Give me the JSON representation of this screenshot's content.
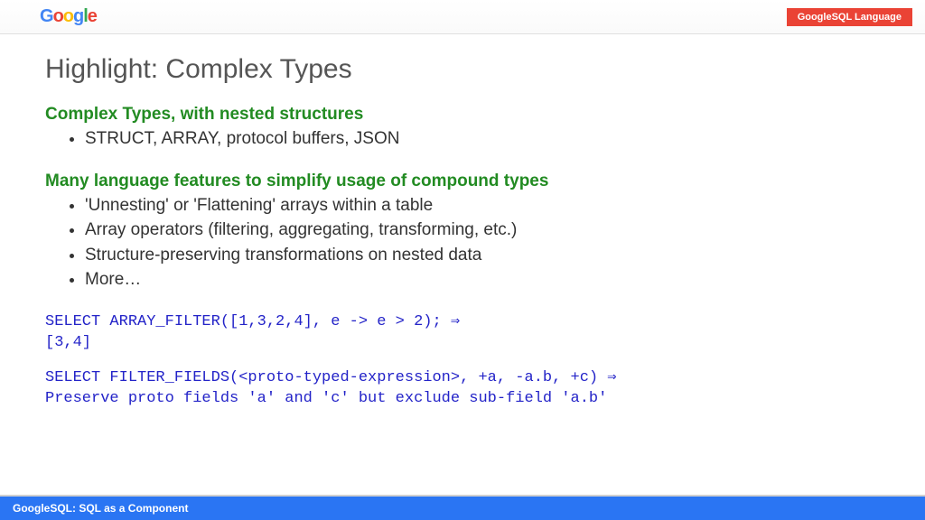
{
  "header": {
    "logo_letters": [
      "G",
      "o",
      "o",
      "g",
      "l",
      "e"
    ],
    "badge": "GoogleSQL Language"
  },
  "title": "Highlight: Complex Types",
  "section1": {
    "heading": "Complex Types, with nested structures",
    "items": [
      "STRUCT, ARRAY, protocol buffers, JSON"
    ]
  },
  "section2": {
    "heading": "Many language features to simplify usage of compound types",
    "items": [
      "'Unnesting' or 'Flattening' arrays within a table",
      "Array operators (filtering, aggregating, transforming, etc.)",
      "Structure-preserving transformations on nested data",
      "More…"
    ]
  },
  "code1": "SELECT ARRAY_FILTER([1,3,2,4], e -> e > 2); ⇒\n[3,4]",
  "code2": "SELECT FILTER_FIELDS(<proto-typed-expression>, +a, -a.b, +c) ⇒\nPreserve proto fields 'a' and 'c' but exclude sub-field 'a.b'",
  "footer": "GoogleSQL: SQL as a Component"
}
